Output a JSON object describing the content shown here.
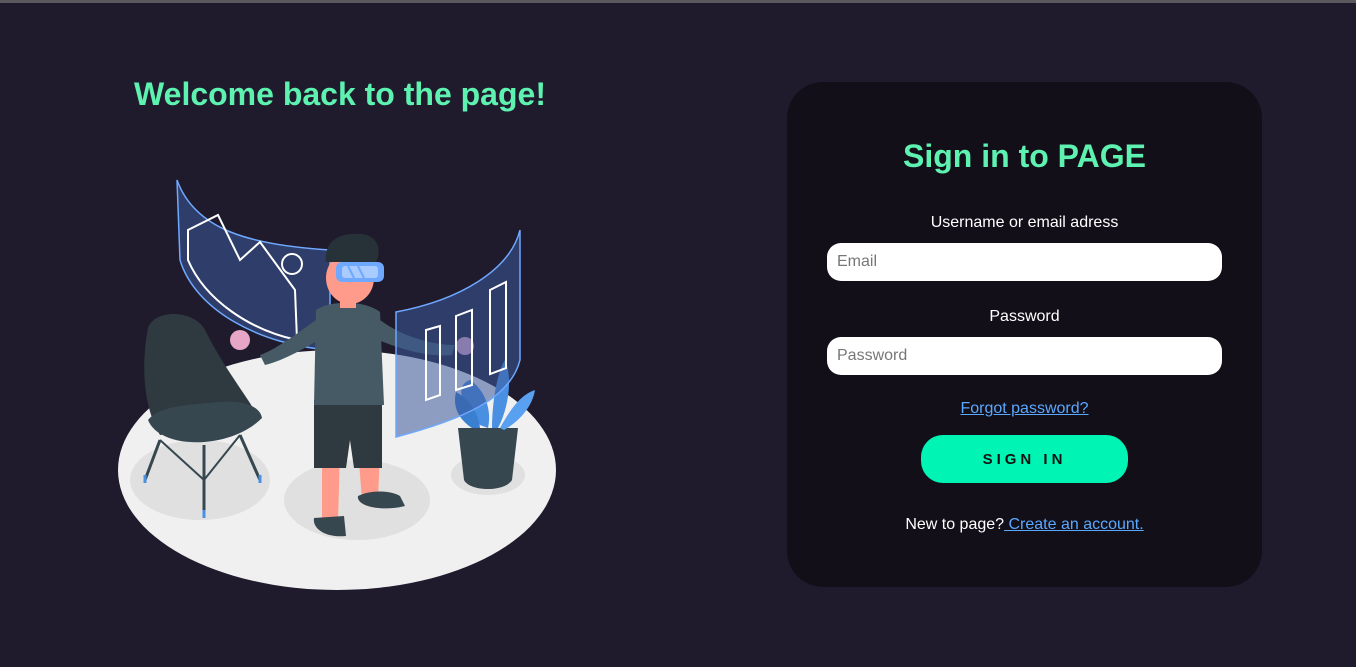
{
  "welcome": {
    "heading": "Welcome back to the page!"
  },
  "signin": {
    "title": "Sign in to PAGE",
    "username_label": "Username or email adress",
    "email_placeholder": "Email",
    "email_value": "",
    "password_label": "Password",
    "password_placeholder": "Password",
    "password_value": "",
    "forgot_link": "Forgot password?",
    "submit_label": "SIGN IN",
    "new_user_text": "New to page?",
    "create_account_link": " Create an account."
  },
  "colors": {
    "background": "#1f1b2d",
    "card": "#120f19",
    "accent_text": "#5ef2b1",
    "button": "#00f5b4",
    "link": "#5aa8ff"
  },
  "illustration": {
    "icon": "vr-person-illustration"
  }
}
